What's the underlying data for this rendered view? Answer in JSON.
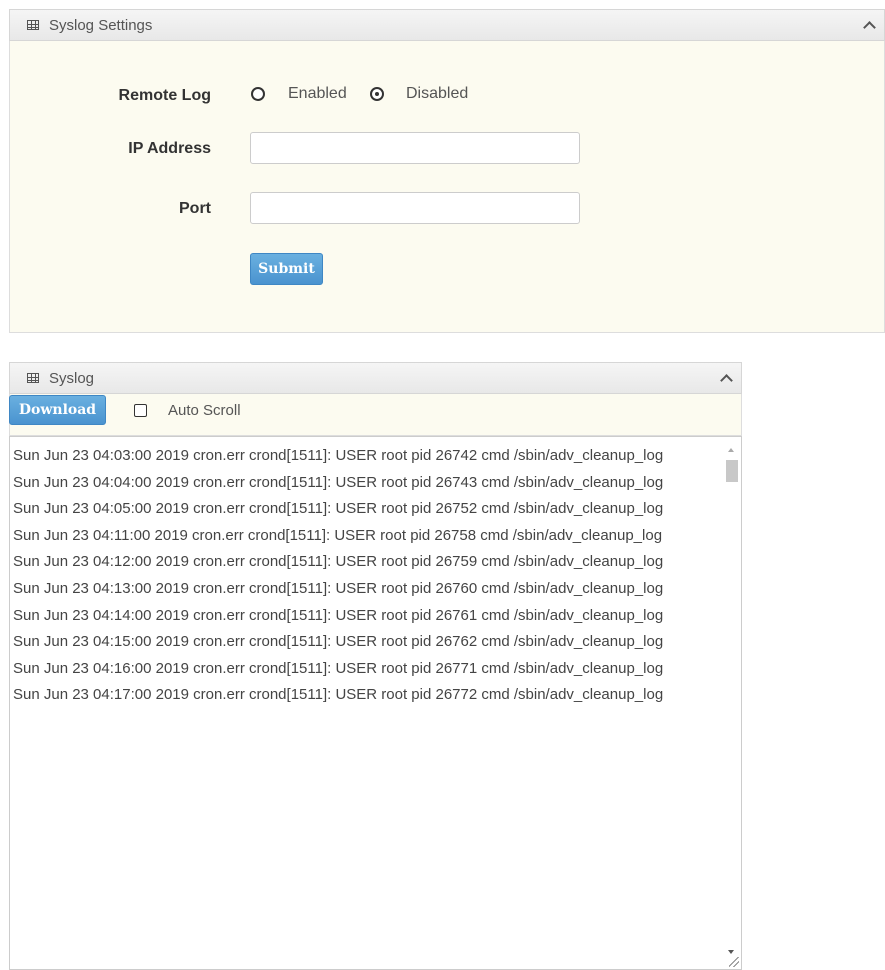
{
  "settings_panel": {
    "title": "Syslog Settings",
    "remote_log_label": "Remote Log",
    "enabled_label": "Enabled",
    "disabled_label": "Disabled",
    "selected": "Disabled",
    "ip_address_label": "IP Address",
    "ip_address_value": "",
    "port_label": "Port",
    "port_value": "",
    "submit_label": "Submit"
  },
  "syslog_panel": {
    "title": "Syslog",
    "download_label": "Download",
    "auto_scroll_label": "Auto Scroll",
    "auto_scroll_checked": false,
    "log_text": "Sun Jun 23 04:03:00 2019 cron.err crond[1511]: USER root pid 26742 cmd /sbin/adv_cleanup_log\nSun Jun 23 04:04:00 2019 cron.err crond[1511]: USER root pid 26743 cmd /sbin/adv_cleanup_log\nSun Jun 23 04:05:00 2019 cron.err crond[1511]: USER root pid 26752 cmd /sbin/adv_cleanup_log\nSun Jun 23 04:11:00 2019 cron.err crond[1511]: USER root pid 26758 cmd /sbin/adv_cleanup_log\nSun Jun 23 04:12:00 2019 cron.err crond[1511]: USER root pid 26759 cmd /sbin/adv_cleanup_log\nSun Jun 23 04:13:00 2019 cron.err crond[1511]: USER root pid 26760 cmd /sbin/adv_cleanup_log\nSun Jun 23 04:14:00 2019 cron.err crond[1511]: USER root pid 26761 cmd /sbin/adv_cleanup_log\nSun Jun 23 04:15:00 2019 cron.err crond[1511]: USER root pid 26762 cmd /sbin/adv_cleanup_log\nSun Jun 23 04:16:00 2019 cron.err crond[1511]: USER root pid 26771 cmd /sbin/adv_cleanup_log\nSun Jun 23 04:17:00 2019 cron.err crond[1511]: USER root pid 26772 cmd /sbin/adv_cleanup_log"
  },
  "colors": {
    "panel_background": "#fcfbf0",
    "button_blue": "#4a93cf"
  }
}
